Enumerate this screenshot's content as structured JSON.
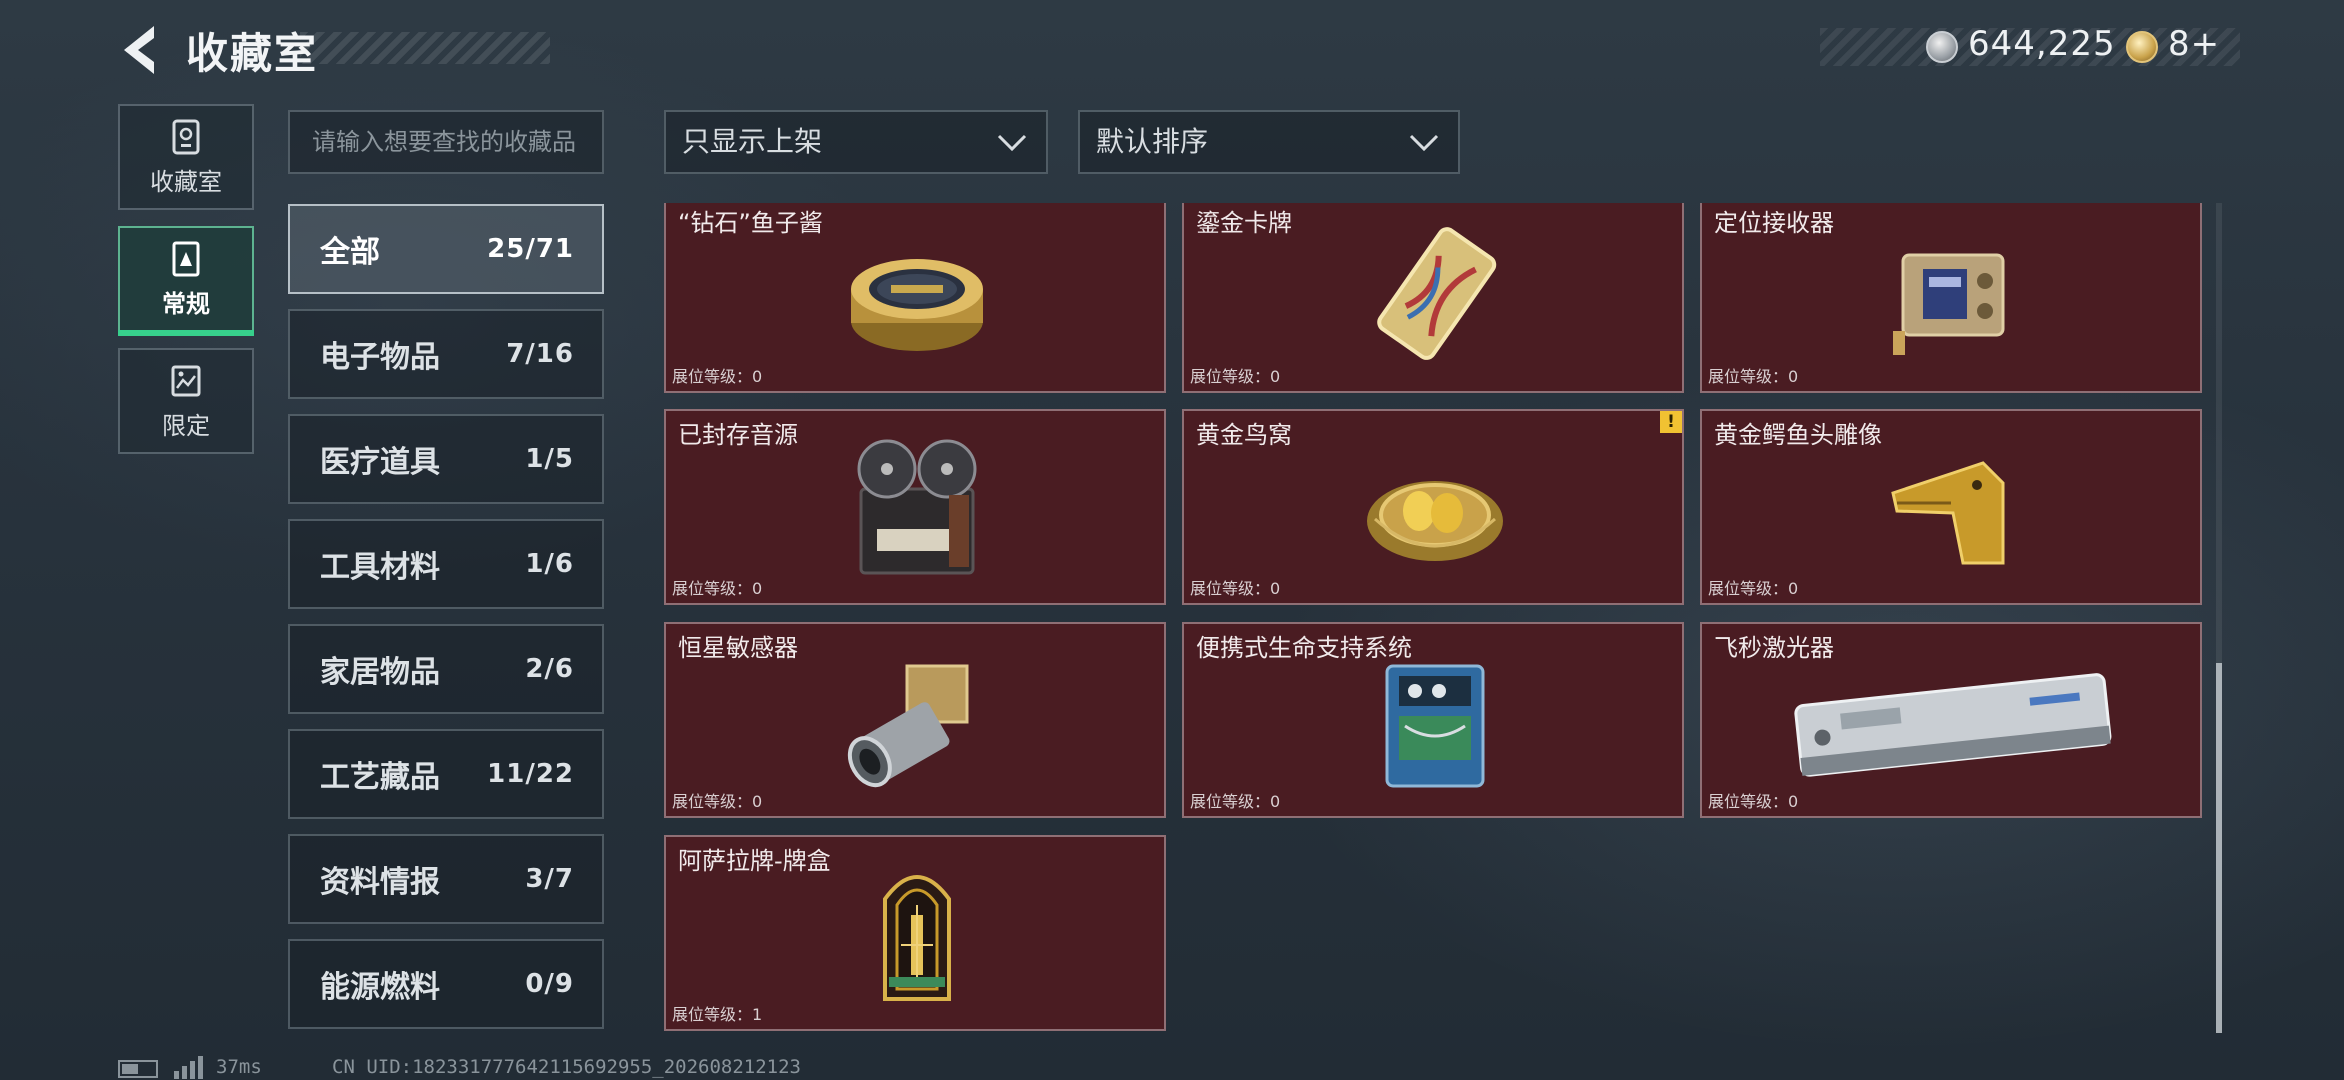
{
  "header": {
    "title": "收藏室",
    "currency_silver": "644,225",
    "currency_gold": "8+"
  },
  "side_tabs": [
    {
      "label": "收藏室",
      "icon": "collection-icon",
      "active": false
    },
    {
      "label": "常规",
      "icon": "regular-icon",
      "active": true
    },
    {
      "label": "限定",
      "icon": "limited-icon",
      "active": false
    }
  ],
  "search": {
    "placeholder": "请输入想要查找的收藏品"
  },
  "filters": {
    "shelf_filter": "只显示上架",
    "sort": "默认排序"
  },
  "categories": [
    {
      "label": "全部",
      "count": "25/71",
      "active": true
    },
    {
      "label": "电子物品",
      "count": "7/16"
    },
    {
      "label": "医疗道具",
      "count": "1/5"
    },
    {
      "label": "工具材料",
      "count": "1/6"
    },
    {
      "label": "家居物品",
      "count": "2/6"
    },
    {
      "label": "工艺藏品",
      "count": "11/22"
    },
    {
      "label": "资料情报",
      "count": "3/7"
    },
    {
      "label": "能源燃料",
      "count": "0/9"
    }
  ],
  "level_label": "展位等级：",
  "items": [
    {
      "name": "“钻石”鱼子酱",
      "level": "0",
      "icon": "caviar-tin-icon"
    },
    {
      "name": "鎏金卡牌",
      "level": "0",
      "icon": "gilded-card-icon"
    },
    {
      "name": "定位接收器",
      "level": "0",
      "icon": "locator-receiver-icon"
    },
    {
      "name": "已封存音源",
      "level": "0",
      "icon": "reel-recorder-icon"
    },
    {
      "name": "黄金鸟窝",
      "level": "0",
      "icon": "golden-nest-icon",
      "alert": "!"
    },
    {
      "name": "黄金鳄鱼头雕像",
      "level": "0",
      "icon": "crocodile-head-icon"
    },
    {
      "name": "恒星敏感器",
      "level": "0",
      "icon": "star-sensor-icon"
    },
    {
      "name": "便携式生命支持系统",
      "level": "0",
      "icon": "life-support-icon"
    },
    {
      "name": "飞秒激光器",
      "level": "0",
      "icon": "femtosecond-laser-icon"
    },
    {
      "name": "阿萨拉牌-牌盒",
      "level": "1",
      "icon": "card-box-icon"
    }
  ],
  "footer": {
    "ping": "37ms",
    "uid": "CN UID:182331777642115692955_202608212123"
  },
  "colors": {
    "card_bg": "#4a1c22",
    "active_accent": "#37d08c",
    "alert": "#f1c232"
  }
}
